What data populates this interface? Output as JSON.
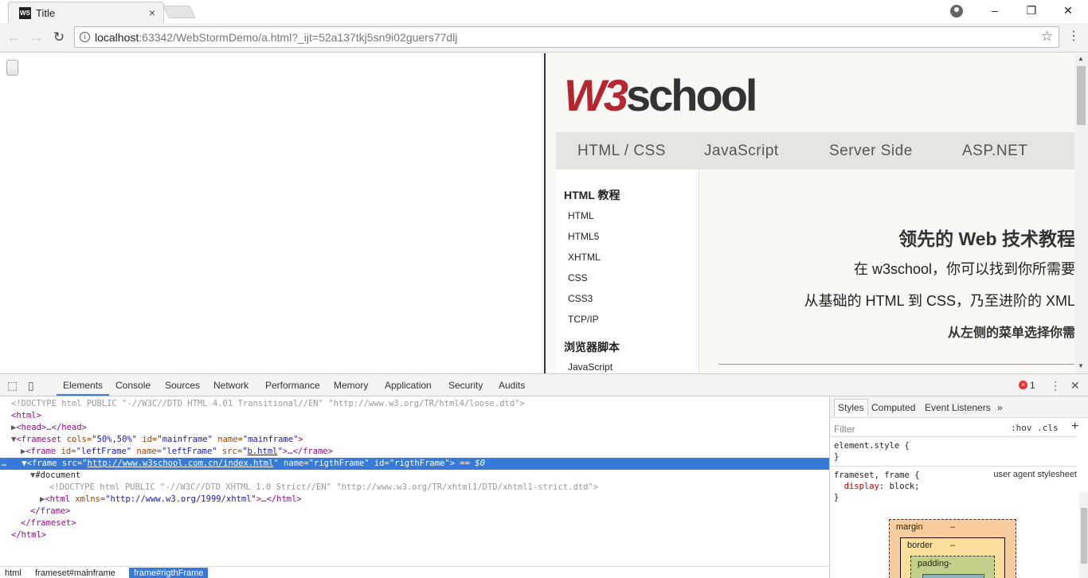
{
  "browser": {
    "tab_title": "Title",
    "tab_close": "×",
    "favicon_text": "WS",
    "url_host": "localhost",
    "url_rest": ":63342/WebStormDemo/a.html?_ijt=52a137tkj5sn9i02guers77dlj",
    "back": "←",
    "forward": "→",
    "reload": "↻",
    "star": "☆",
    "menu": "⋮",
    "minimize": "–",
    "maximize": "❐",
    "close": "✕"
  },
  "w3school": {
    "logo_w3": "W3",
    "logo_school": "school",
    "nav": [
      "HTML / CSS",
      "JavaScript",
      "Server Side",
      "ASP.NET"
    ],
    "menu_heading1": "HTML 教程",
    "menu_items": [
      "HTML",
      "HTML5",
      "XHTML",
      "CSS",
      "CSS3",
      "TCP/IP"
    ],
    "menu_heading2": "浏览器脚本",
    "menu_item_js": "JavaScript",
    "hero_line1": "领先的 Web 技术教程",
    "hero_line2": "在 w3school，你可以找到你所需要",
    "hero_line3": "从基础的 HTML 到 CSS，乃至进阶的 XML",
    "hero_line4": "从左侧的菜单选择你需"
  },
  "devtools": {
    "tabs": [
      "Elements",
      "Console",
      "Sources",
      "Network",
      "Performance",
      "Memory",
      "Application",
      "Security",
      "Audits"
    ],
    "active_tab": "Elements",
    "error_count": "1",
    "dom": {
      "l1": "<!DOCTYPE html PUBLIC \"-//W3C//DTD HTML 4.01 Transitional//EN\" \"http://www.w3.org/TR/html4/loose.dtd\">",
      "l2": "<html>",
      "l3_tag": "<head>",
      "l3_rest": "…</head>",
      "l4_open": "<frameset",
      "l4_a1": " cols=",
      "l4_v1": "\"50%,50%\"",
      "l4_a2": " id=",
      "l4_v2": "\"mainframe\"",
      "l4_a3": " name=",
      "l4_v3": "\"mainframe\"",
      "l4_close": ">",
      "l5_open": "<frame",
      "l5_a1": " id=",
      "l5_v1": "\"leftFrame\"",
      "l5_a2": " name=",
      "l5_v2": "\"leftFrame\"",
      "l5_a3": " src=",
      "l5_q1": "\"",
      "l5_link": "b.html",
      "l5_q2": "\"",
      "l5_rest": ">…</frame>",
      "l6_dots": "…",
      "l6_open": "<frame",
      "l6_a1": " src=",
      "l6_q1": "\"",
      "l6_link": "http://www.w3school.com.cn/index.html",
      "l6_q2": "\"",
      "l6_a2": " name=",
      "l6_v2": "\"rigthFrame\"",
      "l6_a3": " id=",
      "l6_v3": "\"rigthFrame\"",
      "l6_close": ">",
      "l6_eq": " == $0",
      "l7": "#document",
      "l8": "<!DOCTYPE html PUBLIC \"-//W3C//DTD XHTML 1.0 Strict//EN\" \"http://www.w3.org/TR/xhtml1/DTD/xhtml1-strict.dtd\">",
      "l9_open": "<html",
      "l9_a": " xmlns=",
      "l9_v": "\"http://www.w3.org/1999/xhtml\"",
      "l9_rest": ">…</html>",
      "l10": "</frame>",
      "l11": "</frameset>",
      "l12": "</html>"
    },
    "breadcrumbs": [
      "html",
      "frameset#mainframe",
      "frame#rigthFrame"
    ],
    "styles_tabs": [
      "Styles",
      "Computed",
      "Event Listeners",
      "»"
    ],
    "filter_placeholder": "Filter",
    "hov_cls": ":hov  .cls",
    "plus": "+",
    "rule1_sel": "element.style {",
    "rule1_end": "}",
    "rule2_sel": "frameset, frame {",
    "rule2_source": "user agent stylesheet",
    "rule2_prop": "display",
    "rule2_val": ": block;",
    "rule2_end": "}",
    "box_margin": "margin",
    "box_margin_val": "–",
    "box_border": "border",
    "box_border_val": "–",
    "box_padding": "padding-"
  }
}
